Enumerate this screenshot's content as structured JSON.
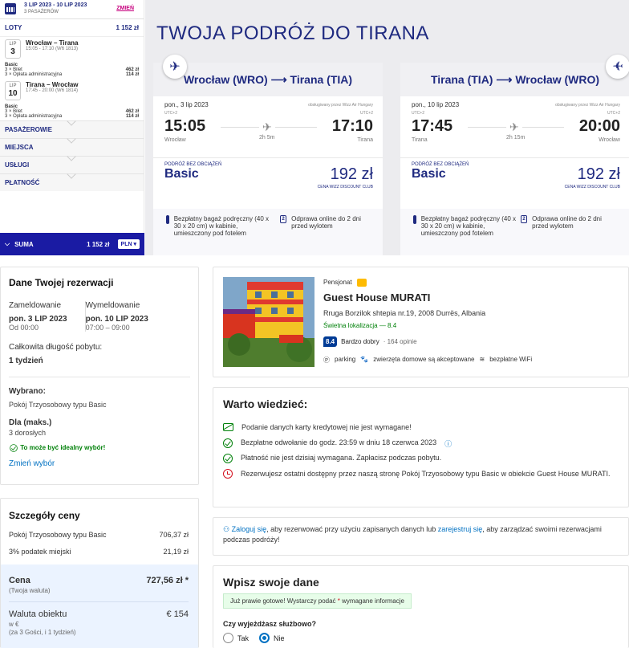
{
  "sidebar": {
    "dates": "3 LIP 2023 - 10 LIP 2023",
    "passengers": "3 PASAŻERÓW",
    "change": "ZMIEŃ",
    "flights_label": "LOTY",
    "flights_total": "1 152 zł",
    "flight1": {
      "month": "LIP",
      "day": "3",
      "route": "Wrocław – Tirana",
      "time": "15:05 - 17:10 (W6 1813)",
      "fare": "Basic",
      "bilet": "3 × Bilet",
      "bilet_price": "462 zł",
      "fee": "3 × Opłata administracyjna",
      "fee_price": "114 zł"
    },
    "flight2": {
      "month": "LIP",
      "day": "10",
      "route": "Tirana – Wrocław",
      "time": "17:45 - 20:00 (W6 1814)",
      "fare": "Basic",
      "bilet": "3 × Bilet",
      "bilet_price": "462 zł",
      "fee": "3 × Opłata administracyjna",
      "fee_price": "114 zł"
    },
    "sections": [
      "PASAŻEROWIE",
      "MIEJSCA",
      "USŁUGI",
      "PŁATNOŚĆ"
    ],
    "suma": "SUMA",
    "suma_total": "1 152 zł",
    "currency": "PLN"
  },
  "wizz": {
    "title": "TWOJA PODRÓŻ DO TIRANA",
    "out": {
      "header": "Wrocław (WRO) ⟶ Tirana (TIA)",
      "date": "pon., 3 lip 2023",
      "operator": "obsługiwany przez Wizz Air Hungary",
      "utc_dep": "UTC+2",
      "utc_arr": "UTC+2",
      "dep": "15:05",
      "arr": "17:10",
      "duration": "2h 5m",
      "city_dep": "Wrocław",
      "city_arr": "Tirana",
      "bundle_label": "PODRÓŻ BEZ OBCIĄŻEŃ",
      "bundle": "Basic",
      "price": "192 zł",
      "price_note": "CENA WIZZ DISCOUNT CLUB",
      "feat1": "Bezpłatny bagaż podręczny (40 x 30 x 20 cm) w kabinie, umieszczony pod fotelem",
      "feat2_num": "2",
      "feat2": "Odprawa online do 2 dni przed wylotem"
    },
    "ret": {
      "header": "Tirana (TIA) ⟶ Wrocław (WRO)",
      "date": "pon., 10 lip 2023",
      "operator": "obsługiwany przez Wizz Air Hungary",
      "utc_dep": "UTC+2",
      "utc_arr": "UTC+2",
      "dep": "17:45",
      "arr": "20:00",
      "duration": "2h 15m",
      "city_dep": "Tirana",
      "city_arr": "Wrocław",
      "bundle_label": "PODRÓŻ BEZ OBCIĄŻEŃ",
      "bundle": "Basic",
      "price": "192 zł",
      "price_note": "CENA WIZZ DISCOUNT CLUB",
      "feat1": "Bezpłatny bagaż podręczny (40 x 30 x 20 cm) w kabinie, umieszczony pod fotelem",
      "feat2_num": "2",
      "feat2": "Odprawa online do 2 dni przed wylotem"
    }
  },
  "booking": {
    "title": "Dane Twojej rezerwacji",
    "checkin_label": "Zameldowanie",
    "checkin_date": "pon. 3 LIP 2023",
    "checkin_time": "Od 00:00",
    "checkout_label": "Wymeldowanie",
    "checkout_date": "pon. 10 LIP 2023",
    "checkout_time": "07:00 – 09:00",
    "length_label": "Całkowita długość pobytu:",
    "length": "1 tydzień",
    "chosen_label": "Wybrano:",
    "chosen": "Pokój Trzyosobowy typu Basic",
    "for_label": "Dla (maks.)",
    "for": "3 dorosłych",
    "ideal": "To może być idealny wybór!",
    "change_choice": "Zmień wybór"
  },
  "price": {
    "title": "Szczegóły ceny",
    "room_label": "Pokój Trzyosobowy typu Basic",
    "room_price": "706,37 zł",
    "tax_label": "3% podatek miejski",
    "tax_price": "21,19 zł",
    "total_label": "Cena",
    "total_sub": "(Twoja waluta)",
    "total": "727,56 zł *",
    "local_label": "Waluta obiektu",
    "local_sub1": "w €",
    "local_sub2": "(za 3 Gości, i 1 tydzień)",
    "local": "€ 154"
  },
  "hotel": {
    "type": "Pensjonat",
    "name": "Guest House MURATI",
    "address": "Rruga Borzilok shtepia nr.19, 2008 Durrës, Albania",
    "location": "Świetna lokalizacja — 8.4",
    "score": "8.4",
    "score_word": "Bardzo dobry",
    "reviews": "· 164 opinie",
    "amenities": [
      "parking",
      "zwierzęta domowe są akceptowane",
      "bezpłatne WiFi"
    ]
  },
  "worth": {
    "title": "Warto wiedzieć:",
    "items": [
      "Podanie danych karty kredytowej nie jest wymagane!",
      "Bezpłatne odwołanie do godz. 23:59 w dniu 18 czerwca 2023",
      "Płatność nie jest dzisiaj wymagana. Zapłacisz podczas pobytu.",
      "Rezerwujesz ostatni dostępny przez naszą stronę Pokój Trzyosobowy typu Basic w obiekcie Guest House MURATI."
    ]
  },
  "login": {
    "link1": "Zaloguj się",
    "text1": ", aby rezerwować przy użyciu zapisanych danych lub",
    "link2": "zarejestruj się",
    "text2": ", aby zarządzać swoimi rezerwacjami podczas podróży!"
  },
  "form": {
    "title": "Wpisz swoje dane",
    "notice_a": "Już prawie gotowe! Wystarczy podać",
    "notice_star": "*",
    "notice_b": "wymagane informacje",
    "business_q": "Czy wyjeżdżasz służbowo?",
    "yes": "Tak",
    "no": "Nie"
  }
}
